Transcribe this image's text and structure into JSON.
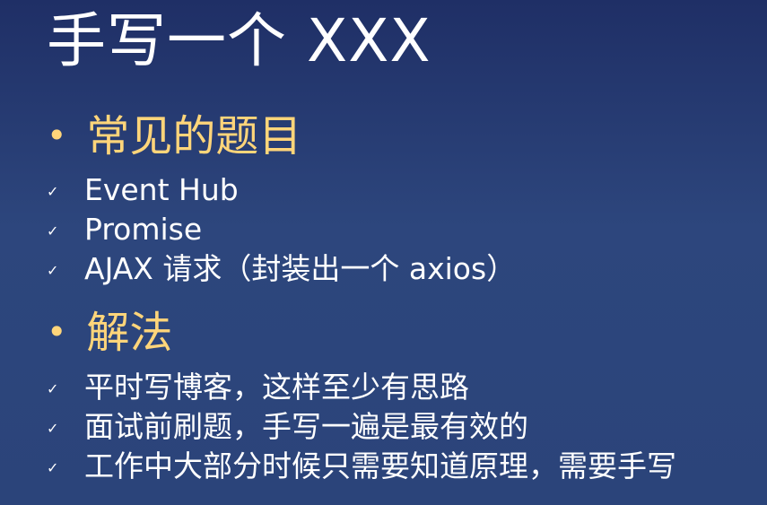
{
  "title": "手写一个 XXX",
  "sections": [
    {
      "label": "常见的题目",
      "items": [
        "Event Hub",
        "Promise",
        "AJAX 请求（封装出一个 axios）"
      ]
    },
    {
      "label": "解法",
      "items": [
        "平时写博客，这样至少有思路",
        "面试前刷题，手写一遍是最有效的",
        "工作中大部分时候只需要知道原理，需要手写"
      ]
    }
  ],
  "symbols": {
    "bullet": "•",
    "check": "✓"
  },
  "colors": {
    "background_top": "#1f2f66",
    "background_bottom": "#2b447a",
    "title": "#ffffff",
    "section_label": "#ffd57a",
    "text": "#ffffff"
  }
}
